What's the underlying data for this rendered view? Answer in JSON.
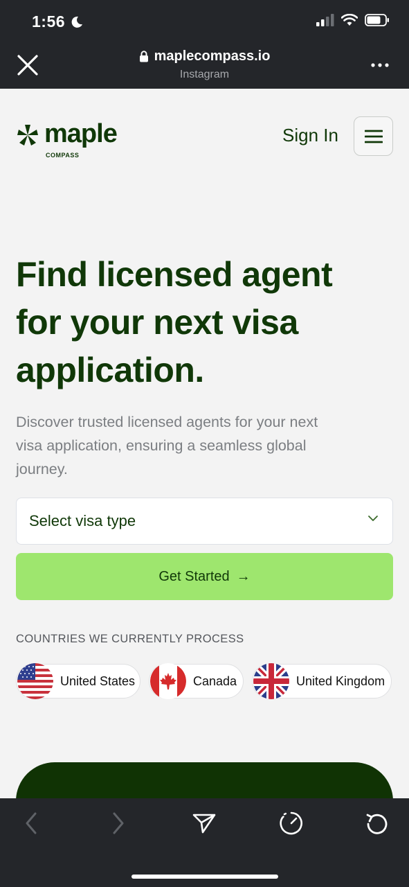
{
  "status_bar": {
    "time": "1:56"
  },
  "browser": {
    "url": "maplecompass.io",
    "source": "Instagram"
  },
  "header": {
    "logo_text": "maple",
    "logo_subtext": "COMPASS",
    "sign_in": "Sign In"
  },
  "hero": {
    "title": "Find licensed agent for your next visa application.",
    "subtitle": "Discover trusted licensed agents for your next visa application, ensuring a seamless global journey."
  },
  "visa_select": {
    "placeholder": "Select visa type"
  },
  "cta": {
    "label": "Get Started",
    "arrow": "→"
  },
  "countries": {
    "heading": "COUNTRIES WE CURRENTLY PROCESS",
    "items": [
      {
        "name": "United States",
        "flag": "us-flag-icon"
      },
      {
        "name": "Canada",
        "flag": "canada-flag-icon"
      },
      {
        "name": "United Kingdom",
        "flag": "uk-flag-icon"
      }
    ]
  },
  "colors": {
    "brand_dark": "#103808",
    "accent_green": "#9ee66e",
    "chrome": "#24262a"
  }
}
